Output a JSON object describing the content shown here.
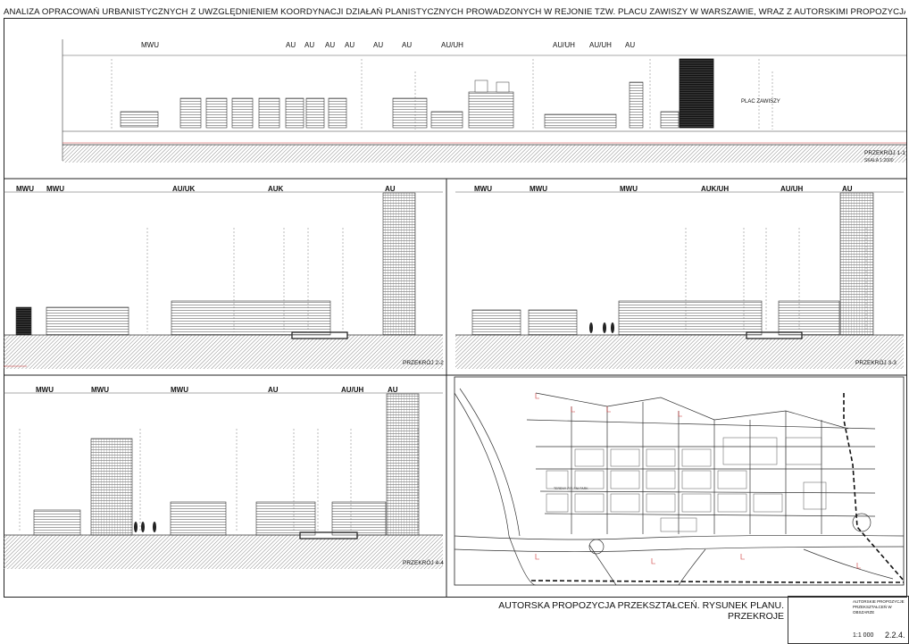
{
  "sheet_title": "ANALIZA  OPRACOWAŃ URBANISTYCZNYCH Z UWZGLĘDNIENIEM KOORDYNACJI DZIAŁAŃ PLANISTYCZNYCH PROWADZONYCH W REJONIE TZW.  PLACU ZAWISZY  W  WARSZAWIE, WRAZ  Z AUTORSKIMI PROPOZYCJAMI ZMIAN W TYM OBSZARZE",
  "section_1": {
    "title": "PRZEKRÓJ 1-1",
    "scale": "SKALA 1:2000",
    "labels": [
      "MWU",
      "AU",
      "AU",
      "AU",
      "AU",
      "AU",
      "AU",
      "AU/UH",
      "AU/UH",
      "AU/UH",
      "AU"
    ],
    "place_label": "PLAC ZAWISZY"
  },
  "section_2": {
    "title": "PRZEKRÓJ 2-2",
    "labels": [
      "MWU",
      "MWU",
      "AU/UK",
      "AUK",
      "AU"
    ]
  },
  "section_3": {
    "title": "PRZEKRÓJ 3-3",
    "labels": [
      "MWU",
      "MWU",
      "MWU",
      "AUK/UH",
      "AU/UH",
      "AU"
    ]
  },
  "section_4": {
    "title": "PRZEKRÓJ 4-4",
    "labels": [
      "MWU",
      "MWU",
      "MWU",
      "AU",
      "AU/UH",
      "AU"
    ]
  },
  "footer": {
    "title_line1": "AUTORSKA PROPOZYCJA PRZEKSZTAŁCEŃ. RYSUNEK PLANU.",
    "title_line2": "PRZEKROJE",
    "scale": "1:1 000",
    "sheet_number": "2.2.4.",
    "stamp_heading": "AUTORSKIE PROPOZYCJE PRZEKSZTAŁCEŃ W OBSZARZE"
  }
}
